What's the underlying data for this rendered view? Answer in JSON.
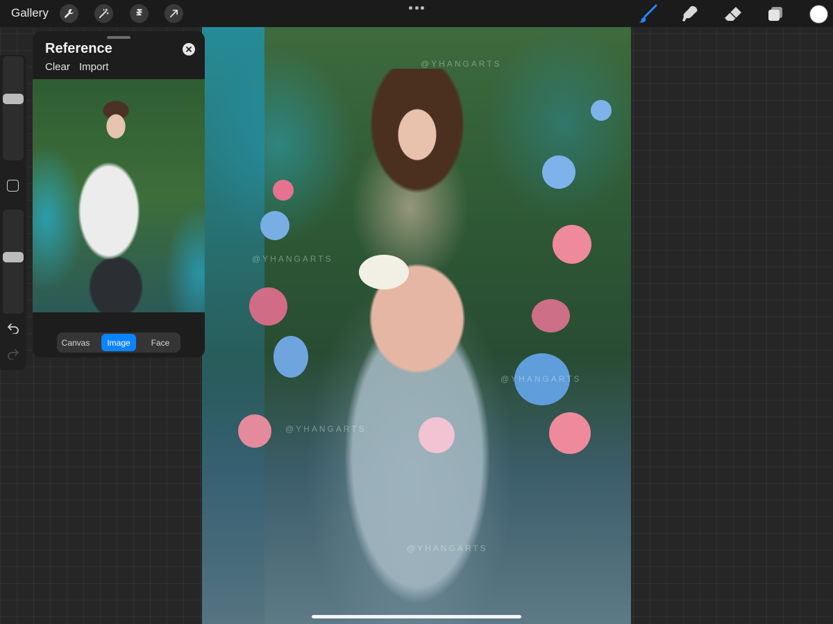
{
  "toolbar": {
    "gallery_label": "Gallery",
    "left_tools": [
      "wrench-icon",
      "magic-wand-icon",
      "selection-icon",
      "transform-arrow-icon"
    ],
    "right_tools": [
      "brush-icon",
      "smudge-icon",
      "eraser-icon",
      "layers-icon"
    ],
    "active_tool": "brush-icon",
    "accent_color": "#0a84ff",
    "current_color": "#ffffff"
  },
  "sidebar": {
    "brush_size_level": 0.6,
    "opacity_level": 0.55
  },
  "reference": {
    "title": "Reference",
    "clear_label": "Clear",
    "import_label": "Import",
    "tabs": [
      "Canvas",
      "Image",
      "Face"
    ],
    "active_tab": "Image"
  },
  "canvas": {
    "watermark": "@YHANGARTS"
  }
}
